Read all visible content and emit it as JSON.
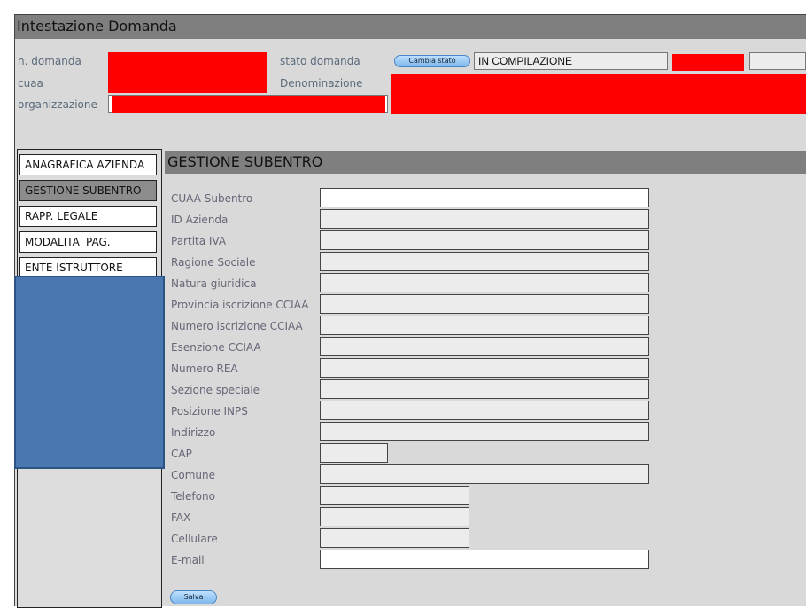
{
  "header": {
    "title": "Intestazione Domanda",
    "labels": {
      "n_domanda": "n. domanda",
      "cuaa": "cuaa",
      "organizzazione": "organizzazione",
      "stato_domanda": "stato domanda",
      "denominazione": "Denominazione"
    },
    "cambia_stato_label": "Cambia stato",
    "stato_value": "IN COMPILAZIONE"
  },
  "sidebar": {
    "items": [
      {
        "label": "ANAGRAFICA AZIENDA"
      },
      {
        "label": "GESTIONE SUBENTRO"
      },
      {
        "label": "RAPP. LEGALE"
      },
      {
        "label": "MODALITA' PAG."
      },
      {
        "label": "ENTE ISTRUTTORE"
      }
    ]
  },
  "section": {
    "title": "GESTIONE SUBENTRO",
    "fields": [
      {
        "label": "CUAA Subentro",
        "value": ""
      },
      {
        "label": "ID Azienda",
        "value": ""
      },
      {
        "label": "Partita IVA",
        "value": ""
      },
      {
        "label": "Ragione Sociale",
        "value": ""
      },
      {
        "label": "Natura giuridica",
        "value": ""
      },
      {
        "label": "Provincia iscrizione CCIAA",
        "value": ""
      },
      {
        "label": "Numero iscrizione CCIAA",
        "value": ""
      },
      {
        "label": "Esenzione CCIAA",
        "value": ""
      },
      {
        "label": "Numero REA",
        "value": ""
      },
      {
        "label": "Sezione speciale",
        "value": ""
      },
      {
        "label": "Posizione INPS",
        "value": ""
      },
      {
        "label": "Indirizzo",
        "value": ""
      },
      {
        "label": "CAP",
        "value": ""
      },
      {
        "label": "Comune",
        "value": ""
      },
      {
        "label": "Telefono",
        "value": ""
      },
      {
        "label": "FAX",
        "value": ""
      },
      {
        "label": "Cellulare",
        "value": ""
      },
      {
        "label": "E-mail",
        "value": ""
      }
    ],
    "save_label": "Salva"
  },
  "colors": {
    "header_bar": "#7f7f7f",
    "panel_bg": "#d9d9d9",
    "redaction": "#ff0000",
    "overlay_block": "#4a77b0",
    "selected_menu": "#8c8c8c"
  }
}
